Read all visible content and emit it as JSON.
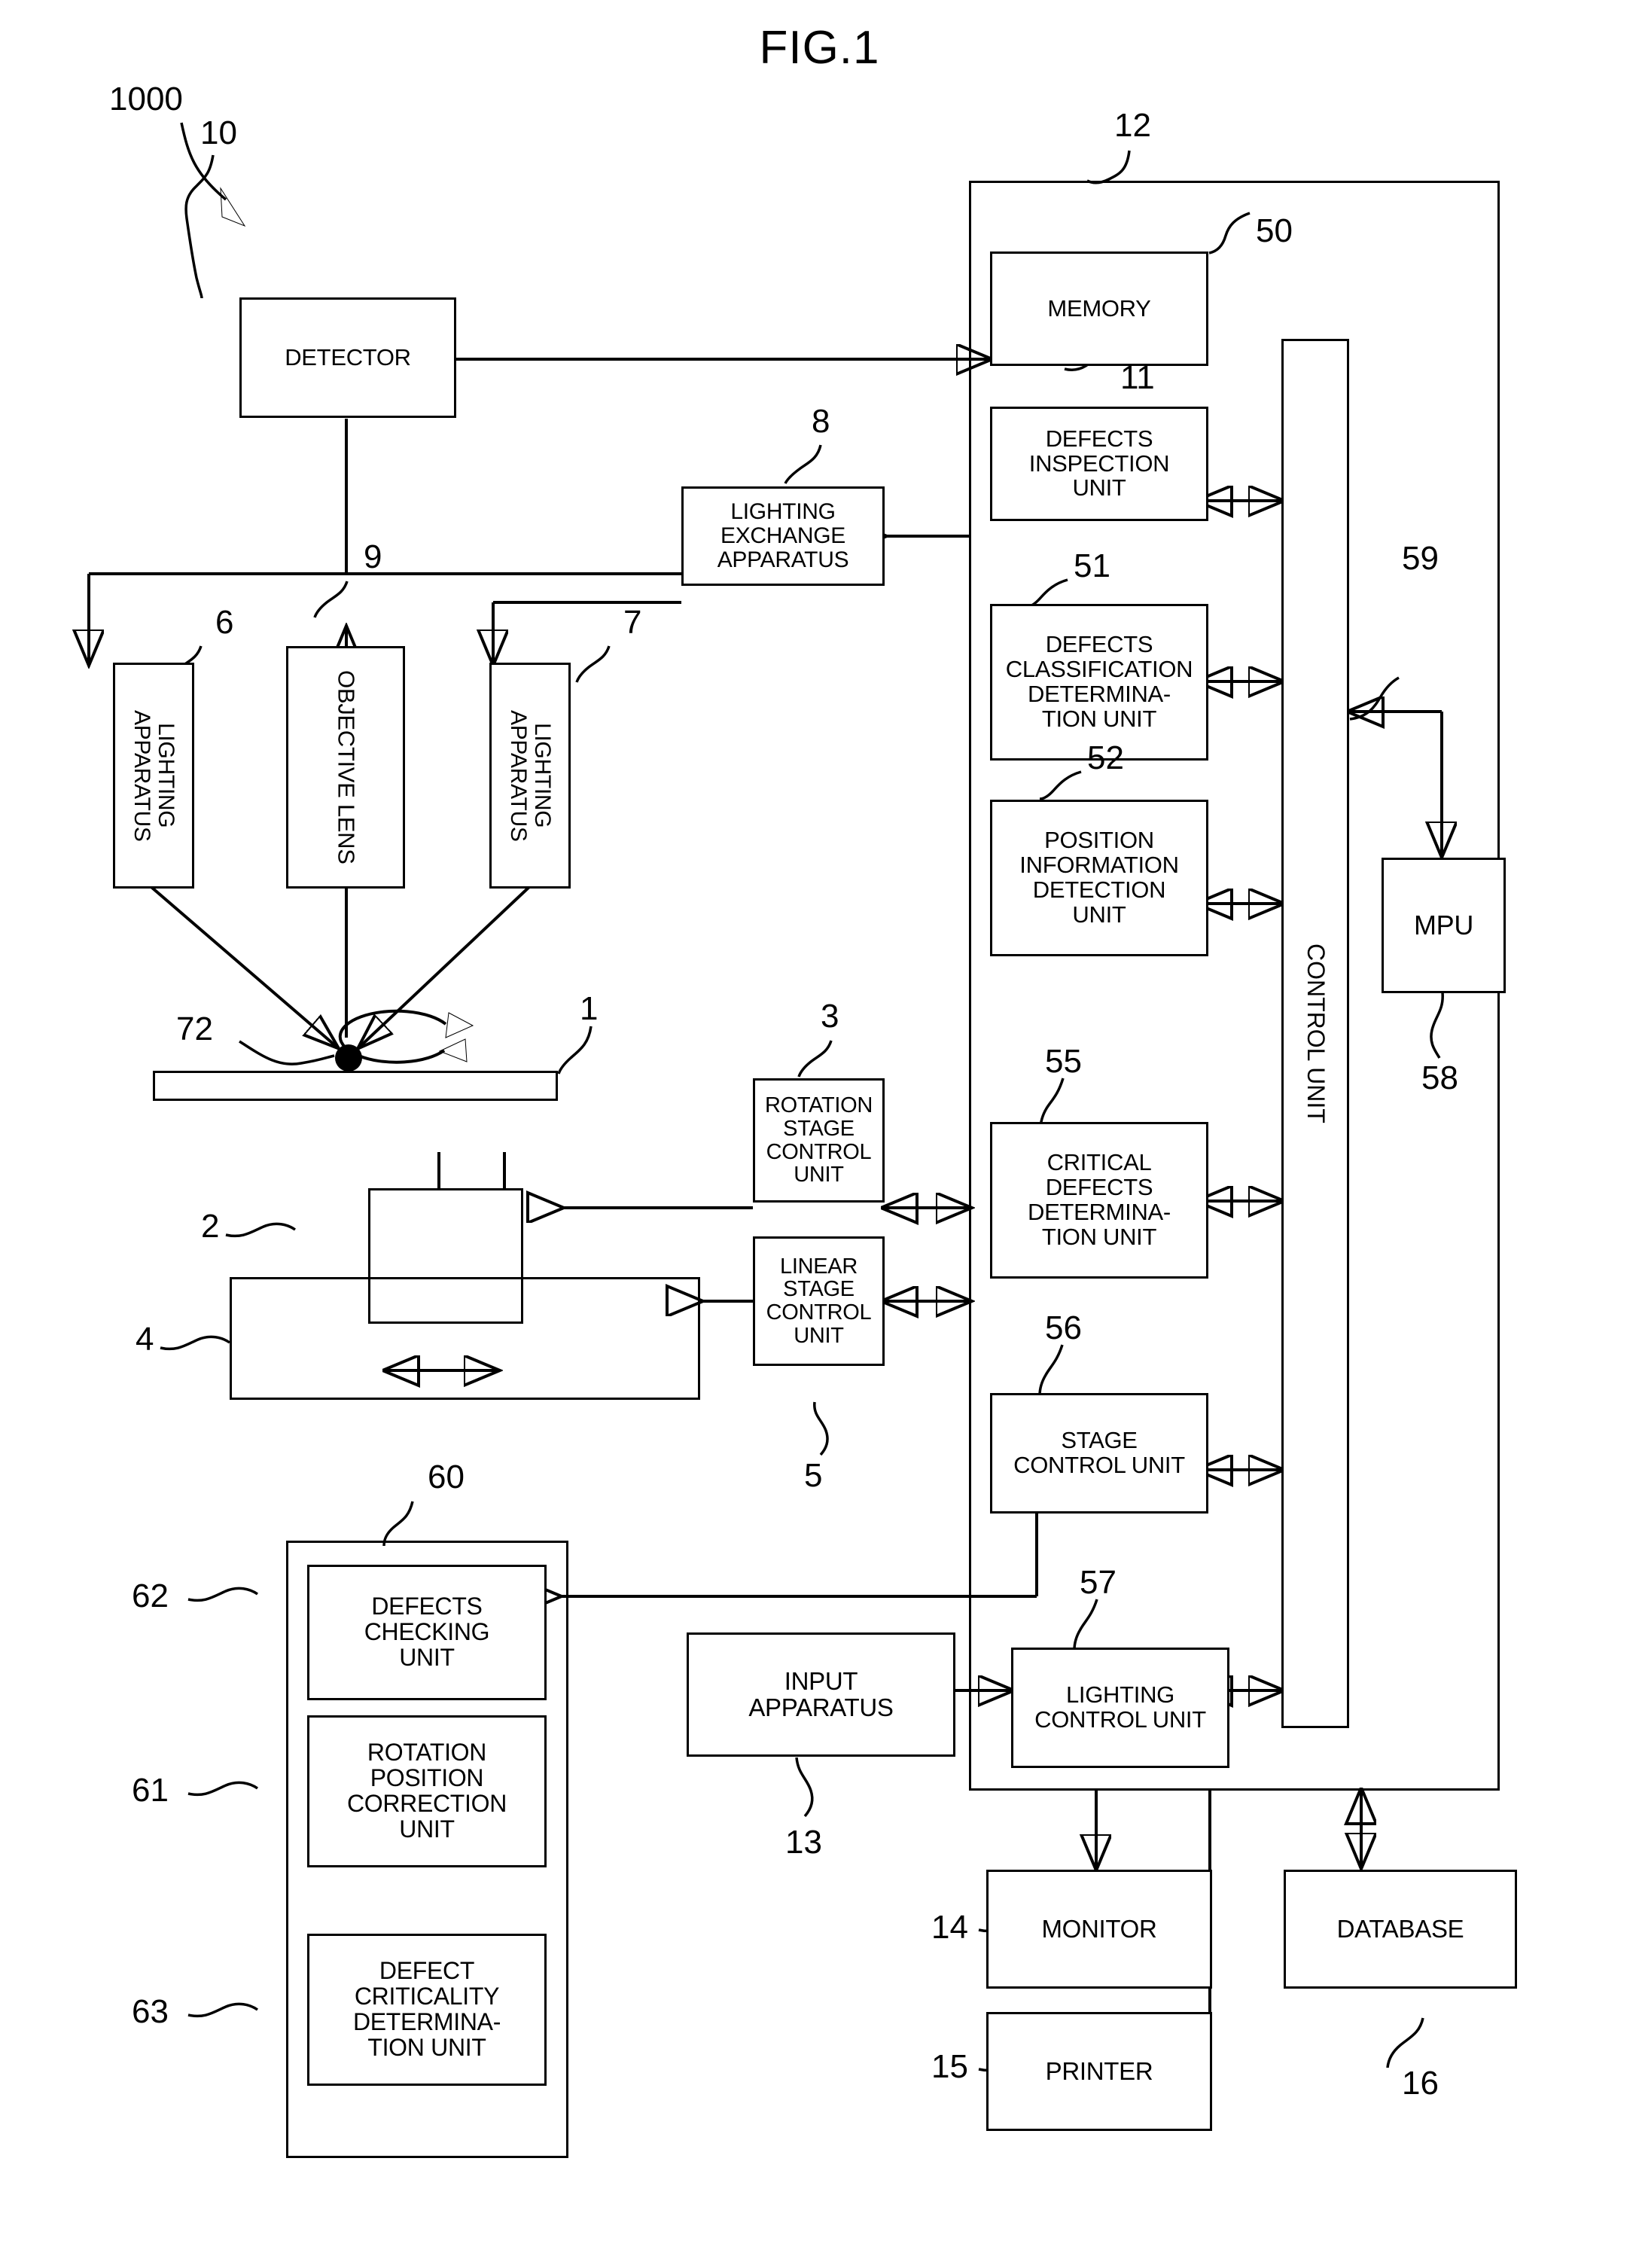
{
  "figure": {
    "title": "FIG.1",
    "system_numeral": "1000"
  },
  "blocks": {
    "detector": {
      "label": "DETECTOR",
      "numeral": "10"
    },
    "lighting_exchange": {
      "label": "LIGHTING\nEXCHANGE\nAPPARATUS",
      "numeral": "8"
    },
    "lighting_apparatus_l": {
      "label": "LIGHTING\nAPPARATUS",
      "numeral": "6"
    },
    "objective_lens": {
      "label": "OBJECTIVE LENS",
      "numeral": "9"
    },
    "lighting_apparatus_r": {
      "label": "LIGHTING\nAPPARATUS",
      "numeral": "7"
    },
    "wafer_stage": {
      "label": "",
      "numeral": "1"
    },
    "defect_point": {
      "label": "",
      "numeral": "72"
    },
    "rotation_stage": {
      "label": "",
      "numeral": "2"
    },
    "linear_stage": {
      "label": "",
      "numeral": "4"
    },
    "rotation_stage_ctrl": {
      "label": "ROTATION\nSTAGE\nCONTROL\nUNIT",
      "numeral": "3"
    },
    "linear_stage_ctrl": {
      "label": "LINEAR\nSTAGE\nCONTROL\nUNIT",
      "numeral": "5"
    },
    "controller_housing": {
      "label": "",
      "numeral": "12"
    },
    "memory": {
      "label": "MEMORY",
      "numeral": "50"
    },
    "defects_inspection": {
      "label": "DEFECTS\nINSPECTION\nUNIT",
      "numeral": "11"
    },
    "defects_classification": {
      "label": "DEFECTS\nCLASSIFICATION\nDETERMINA-\nTION UNIT",
      "numeral": "51"
    },
    "position_information": {
      "label": "POSITION\nINFORMATION\nDETECTION\nUNIT",
      "numeral": "52"
    },
    "critical_defects": {
      "label": "CRITICAL\nDEFECTS\nDETERMINA-\nTION UNIT",
      "numeral": "55"
    },
    "stage_control": {
      "label": "STAGE\nCONTROL UNIT",
      "numeral": "56"
    },
    "lighting_control": {
      "label": "LIGHTING\nCONTROL UNIT",
      "numeral": "57"
    },
    "control_unit_bus": {
      "label": "CONTROL UNIT",
      "numeral": "59"
    },
    "mpu": {
      "label": "MPU",
      "numeral": "58"
    },
    "input_apparatus": {
      "label": "INPUT\nAPPARATUS",
      "numeral": "13"
    },
    "monitor": {
      "label": "MONITOR",
      "numeral": "14"
    },
    "printer": {
      "label": "PRINTER",
      "numeral": "15"
    },
    "database": {
      "label": "DATABASE",
      "numeral": "16"
    },
    "review_housing": {
      "label": "",
      "numeral": "60"
    },
    "defects_checking": {
      "label": "DEFECTS\nCHECKING\nUNIT",
      "numeral": "62"
    },
    "rotation_position_corr": {
      "label": "ROTATION\nPOSITION\nCORRECTION\nUNIT",
      "numeral": "61"
    },
    "defect_criticality": {
      "label": "DEFECT\nCRITICALITY\nDETERMINA-\nTION UNIT",
      "numeral": "63"
    }
  },
  "colors": {
    "ink": "#000000",
    "paper": "#ffffff"
  }
}
